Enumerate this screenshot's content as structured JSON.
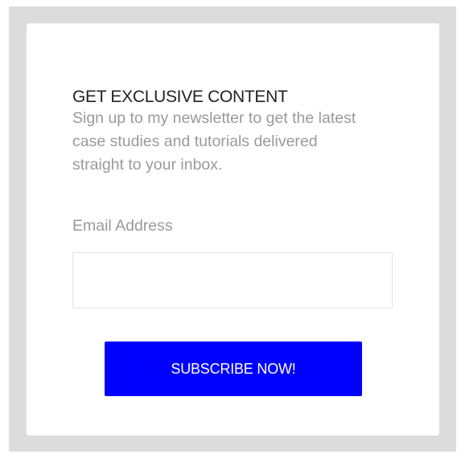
{
  "widget": {
    "heading": "GET EXCLUSIVE CONTENT",
    "description": "Sign up to my newsletter to get the latest case studies and tutorials delivered straight to your inbox.",
    "email_label": "Email Address",
    "email_value": "",
    "email_placeholder": "",
    "button_label": "SUBSCRIBE NOW!"
  },
  "colors": {
    "frame_background": "#dcdcdc",
    "card_background": "#ffffff",
    "heading_text": "#222222",
    "muted_text": "#9a9a9a",
    "input_border": "#e3e3e3",
    "button_background": "#0000ff",
    "button_text": "#ffffff"
  }
}
